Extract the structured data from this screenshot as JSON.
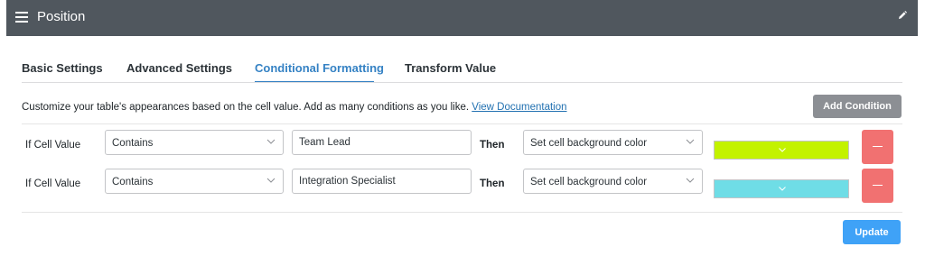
{
  "header": {
    "title": "Position"
  },
  "tabs": [
    {
      "label": "Basic Settings"
    },
    {
      "label": "Advanced Settings"
    },
    {
      "label": "Conditional Formatting"
    },
    {
      "label": "Transform Value"
    }
  ],
  "description": {
    "text": "Customize your table's appearances based on the cell value. Add as many conditions as you like. ",
    "link": "View Documentation"
  },
  "add_condition_label": "Add Condition",
  "conditions": [
    {
      "if_label": "If Cell Value",
      "operator": "Contains",
      "value": "Team Lead",
      "then_label": "Then",
      "action": "Set cell background color",
      "color": "#c3f200"
    },
    {
      "if_label": "If Cell Value",
      "operator": "Contains",
      "value": "Integration Specialist",
      "then_label": "Then",
      "action": "Set cell background color",
      "color": "#6fdde6"
    }
  ],
  "update_label": "Update",
  "icons": {
    "menu": "menu-icon",
    "edit": "pencil-icon",
    "dropdown": "chevron-down-icon",
    "delete": "minus-icon"
  },
  "colors": {
    "header_bg": "#50575e",
    "active_tab": "#3582c4",
    "add_button": "#8c8f94",
    "delete_button": "#f17171",
    "update_button": "#3fa2f7"
  }
}
